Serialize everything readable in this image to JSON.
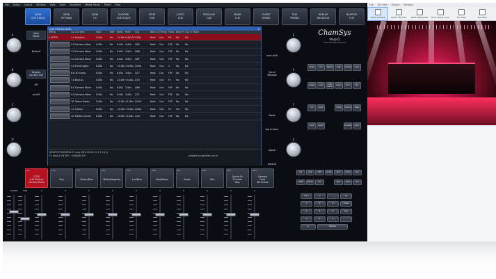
{
  "menus": [
    "File",
    "Setup",
    "Layout",
    "Window",
    "View",
    "Tools",
    "Visualiser",
    "Media Player",
    "Panel",
    "Help"
  ],
  "viewer_menus": [
    "File",
    "3D View",
    "Source",
    "Window"
  ],
  "top_buttons": [
    {
      "line1": "VIEW",
      "line2": "CUE STACK",
      "active": true
    },
    {
      "line1": "VIEW",
      "line2": "OPTIONS",
      "active": false
    },
    {
      "line1": "VIEW",
      "line2": "FX",
      "active": false
    },
    {
      "line1": "CHOOSE",
      "line2": "CUE STACK",
      "active": false
    },
    {
      "line1": "VIEW",
      "line2": "CUE",
      "active": false
    },
    {
      "line1": "GOTO",
      "line2": "CUE",
      "active": false
    },
    {
      "line1": "PRELOAD",
      "line2": "CUE",
      "active": false
    },
    {
      "line1": "MARK",
      "line2": "CUE",
      "active": false
    },
    {
      "line1": "CHASE",
      "line2": "TIMING",
      "active": false
    },
    {
      "line1": "CUE",
      "line2": "TIMING",
      "active": false
    },
    {
      "line1": "RENUM",
      "line2": "RECBOOK",
      "active": false
    },
    {
      "line1": "REMOVE",
      "line2": "CUE",
      "active": false
    }
  ],
  "encoders_left": [
    "A",
    "B",
    "C",
    "D"
  ],
  "encoders_right": [
    "E",
    "F",
    "Y",
    "Z"
  ],
  "left_side": {
    "view_mode": "View\nMode",
    "default": "Default",
    "display_current": "Display\nCurrent Cue",
    "off": "Off",
    "on_off": "on/off"
  },
  "right_side": {
    "next_shift": "next shift",
    "scroll": "Scroll\nWindow",
    "mode": "Mode",
    "tap_to_time": "tap to time",
    "speed": "Speed",
    "default": "default"
  },
  "cue_stack": {
    "title": "CUE STACK (CS2E)",
    "close": "X",
    "headers": [
      "Status",
      "Cue id",
      "Cue text",
      "Wait",
      "Halt",
      "Delay",
      "Fade",
      "Cue",
      "Next cue",
      "Timing",
      "Track",
      "Block FX",
      "Cue Only",
      "Macro"
    ],
    "rows": [
      {
        "status": "1 NTPPL",
        "id": "1.00",
        "text": "Stadium",
        "wait": "0.00s",
        "halt": "No",
        "delay": "<0.00s",
        "fade": "0.4/0.00",
        "cue": "Q4Q1",
        "next": "Next",
        "timing": "Cue",
        "track": "FB",
        "block": "No",
        "only": "No"
      },
      {
        "status": "",
        "id": "2.00",
        "text": "Camera Move",
        "wait": "0.00s",
        "halt": "No",
        "delay": "0.00s",
        "fade": "2.00s",
        "cue": "Q63",
        "next": "Next",
        "timing": "Cue",
        "track": "FEF",
        "block": "No",
        "only": "No"
      },
      {
        "status": "",
        "id": "3.00",
        "text": "Camera Move",
        "wait": "0.00s",
        "halt": "No",
        "delay": "0.00s",
        "fade": "2.00s",
        "cue": "Q66",
        "next": "Next",
        "timing": "Cue",
        "track": "FEF",
        "block": "No",
        "only": "No"
      },
      {
        "status": "",
        "id": "4.00",
        "text": "Camera Move",
        "wait": "0.00s",
        "halt": "No",
        "delay": "0.00s",
        "fade": "4.00s",
        "cue": "Q67",
        "next": "Next",
        "timing": "Cue",
        "track": "FEF",
        "block": "No",
        "only": "No"
      },
      {
        "status": "",
        "id": "5.00",
        "text": "Front Lights",
        "wait": "0.00s",
        "halt": "No",
        "delay": "<1.00s",
        "fade": "<4.00s",
        "cue": "Q49b",
        "next": "Next",
        "timing": "Cue",
        "track": "1",
        "block": "No",
        "only": "No"
      },
      {
        "status": "",
        "id": "6.00",
        "text": "3D Setup",
        "wait": "0.00s",
        "halt": "No",
        "delay": "0.00s",
        "fade": "3.00s",
        "cue": "Q17",
        "next": "Next",
        "timing": "Cue",
        "track": "FEF",
        "block": "No",
        "only": "No"
      },
      {
        "status": "",
        "id": "7.00",
        "text": "Blu/Lav",
        "wait": "0.00s",
        "halt": "No",
        "delay": "<2.00s",
        "fade": "<5.00s",
        "cue": "Q19",
        "next": "Next",
        "timing": "Cue",
        "track": "Fx",
        "block": "No",
        "only": "No"
      },
      {
        "status": "",
        "id": "8.00",
        "text": "Camera Move",
        "wait": "0.00s",
        "halt": "No",
        "delay": "0.00s",
        "fade": "2.00s",
        "cue": "Q68",
        "next": "Next",
        "timing": "Cue",
        "track": "FEF",
        "block": "No",
        "only": "No"
      },
      {
        "status": "",
        "id": "9.00",
        "text": "Camera Move",
        "wait": "0.00s",
        "halt": "No",
        "delay": "0.00s",
        "fade": "2.00s",
        "cue": "Q71",
        "next": "Next",
        "timing": "Cue",
        "track": "FEF",
        "block": "No",
        "only": "No"
      },
      {
        "status": "",
        "id": "10.00",
        "text": "Space Radar",
        "wait": "0.00s",
        "halt": "No",
        "delay": "<1.00s",
        "fade": "<1.00s",
        "cue": "Q109",
        "next": "Next",
        "timing": "Cue",
        "track": "FEF",
        "block": "No",
        "only": "No"
      },
      {
        "status": "",
        "id": "11.00",
        "text": "Indoos",
        "wait": "0.00s",
        "halt": "No",
        "delay": "<0.00s",
        "fade": "<4.00s",
        "cue": "Q28b",
        "next": "Next",
        "timing": "Cue",
        "track": "FX",
        "block": "Yes",
        "only": "No"
      },
      {
        "status": "",
        "id": "12.00",
        "text": "Rd/Blu Circles",
        "wait": "0.00s",
        "halt": "No",
        "delay": "<0.00s",
        "fade": "<2.00s",
        "cue": "Q30",
        "next": "Next",
        "timing": "Cue",
        "track": "FEF",
        "block": "No",
        "only": "No"
      }
    ],
    "footer_line1": "DESKTOP H3DOESA 07 Aug 2018 12:20:11 1.7.9.8_A",
    "footer_line2": "F1 Hold A: RE WTC ~0/80/90.00~",
    "footer_status": "Jumped to specified cue id"
  },
  "logo": {
    "brand": "ChamSys",
    "product": "MagicQ",
    "url": "Chamsyslighting.com"
  },
  "keypad1": [
    [
      "prog",
      "out",
      "setup",
      "pat",
      "media",
      "mso"
    ],
    [
      "page",
      "cue",
      "cue stack",
      "exec",
      "mcr",
      "flx"
    ],
    [
      "ctl",
      "plot",
      "",
      "time",
      "macro",
      "help"
    ],
    [
      "hold",
      "prev",
      "",
      "",
      "locate",
      "solo"
    ]
  ],
  "fkeys": [
    {
      "num": "PB1",
      "label": "CS3E\n0.0s Blu/Lav\nCamera Move",
      "red": true
    },
    {
      "num": "PB2",
      "label": "Play",
      "red": false
    },
    {
      "num": "PB3",
      "label": "Green/Blue",
      "red": false
    },
    {
      "num": "PB4",
      "label": "White/Magenta",
      "red": false
    },
    {
      "num": "PB5",
      "label": "Lav/Blue",
      "red": false
    },
    {
      "num": "PB6",
      "label": "Red/Yellow",
      "red": false
    },
    {
      "num": "PB7",
      "label": "Radar",
      "red": false
    },
    {
      "num": "PB8",
      "label": "Star",
      "red": false
    },
    {
      "num": "PB9",
      "label": "Sound Fx\nThunder\nDay",
      "red": false
    },
    {
      "num": "PB10",
      "label": "Camera\nFront\n3D Screen",
      "red": false
    }
  ],
  "faders": [
    "GRAND",
    "SUB",
    "S",
    "S",
    "S",
    "S",
    "S",
    "S",
    "S",
    "S",
    "S",
    "S"
  ],
  "fader_levels": [
    0.62,
    0.45,
    0.55,
    0.55,
    0.55,
    0.55,
    0.55,
    0.55,
    0.55,
    0.55,
    0.55,
    0.55
  ],
  "gm_buttons": [
    "dbo",
    "rel",
    "swap",
    "flash"
  ],
  "keypad2": [
    [
      "rel",
      "set",
      "dlt",
      "undo",
      "rem",
      "mve",
      "cpy"
    ],
    [
      "shift",
      "blind",
      "inc",
      "",
      "set",
      "upd",
      "rec"
    ],
    [
      "thru",
      "+",
      "-",
      "@"
    ],
    [
      "7",
      "8",
      "9",
      "FULL"
    ],
    [
      "4",
      "5",
      "6",
      "ALL"
    ],
    [
      "1",
      "2",
      "3",
      "."
    ],
    [
      "0",
      "ENTER"
    ]
  ],
  "viewer_tools": [
    {
      "label": "Move Camera",
      "active": true
    },
    {
      "label": "Select Fixtures",
      "active": false
    },
    {
      "label": "Select Elements",
      "active": false
    },
    {
      "label": "Fit to whole room",
      "active": false
    },
    {
      "label": "Fur View",
      "active": false
    },
    {
      "label": "Top View",
      "active": false
    }
  ],
  "colors": {
    "accent": "#2f6fd0",
    "selected_row": "#8b0e1c",
    "stage_pink": "#ff2a70"
  }
}
